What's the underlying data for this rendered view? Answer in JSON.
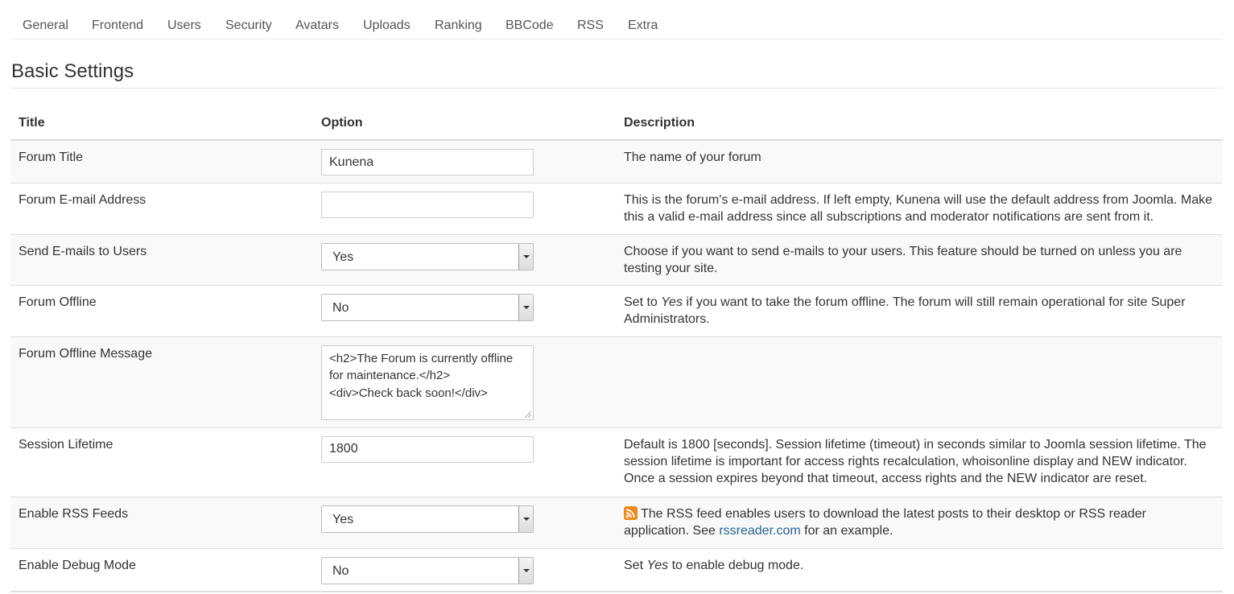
{
  "tabs": [
    "General",
    "Frontend",
    "Users",
    "Security",
    "Avatars",
    "Uploads",
    "Ranking",
    "BBCode",
    "RSS",
    "Extra"
  ],
  "section_title": "Basic Settings",
  "table": {
    "headers": [
      "Title",
      "Option",
      "Description"
    ],
    "rows": {
      "forum_title": {
        "title": "Forum Title",
        "value": "Kunena",
        "description": "The name of your forum"
      },
      "forum_email": {
        "title": "Forum E-mail Address",
        "value": "",
        "description": "This is the forum's e-mail address. If left empty, Kunena will use the default address from Joomla. Make this a valid e-mail address since all subscriptions and moderator notifications are sent from it."
      },
      "send_emails": {
        "title": "Send E-mails to Users",
        "value": "Yes",
        "description": "Choose if you want to send e-mails to your users. This feature should be turned on unless you are testing your site."
      },
      "forum_offline": {
        "title": "Forum Offline",
        "value": "No",
        "description_pre": "Set to ",
        "description_em": "Yes",
        "description_post": " if you want to take the forum offline. The forum will still remain operational for site Super Administrators."
      },
      "offline_message": {
        "title": "Forum Offline Message",
        "value": "<h2>The Forum is currently offline for maintenance.</h2>\n<div>Check back soon!</div>",
        "description": ""
      },
      "session_lifetime": {
        "title": "Session Lifetime",
        "value": "1800",
        "description": "Default is 1800 [seconds]. Session lifetime (timeout) in seconds similar to Joomla session lifetime. The session lifetime is important for access rights recalculation, whoisonline display and NEW indicator. Once a session expires beyond that timeout, access rights and the NEW indicator are reset."
      },
      "enable_rss": {
        "title": "Enable RSS Feeds",
        "value": "Yes",
        "description_pre": "The RSS feed enables users to download the latest posts to their desktop or RSS reader application. See ",
        "description_link": "rssreader.com",
        "description_post": " for an example."
      },
      "debug_mode": {
        "title": "Enable Debug Mode",
        "value": "No",
        "description_pre": "Set ",
        "description_em": "Yes",
        "description_post": " to enable debug mode."
      }
    }
  },
  "colors": {
    "link": "#2a6496",
    "rss_icon": "#f0891d",
    "row_stripe": "#f9f9f9"
  },
  "icons": {
    "rss": "rss-icon",
    "select_arrow": "chevron-down-icon"
  }
}
